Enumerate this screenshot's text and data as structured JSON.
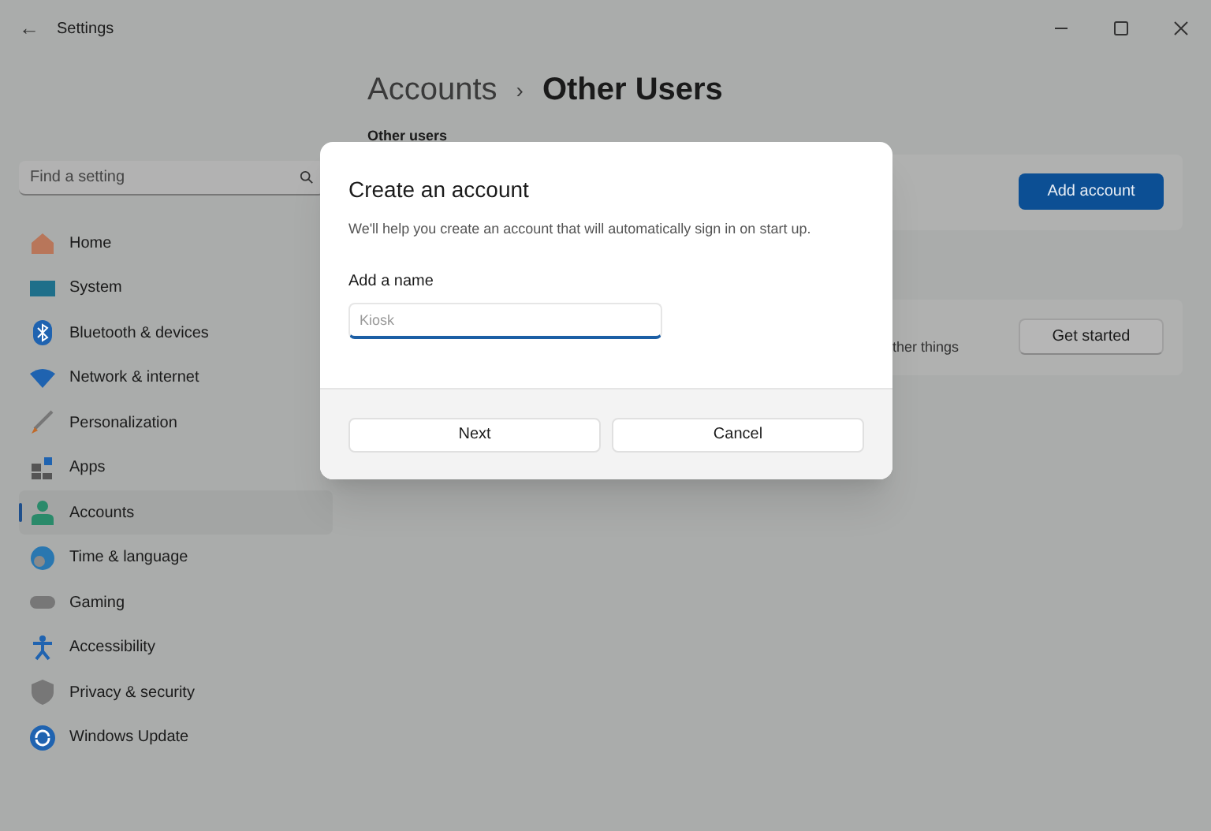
{
  "window": {
    "title": "Settings",
    "back": "←"
  },
  "search": {
    "placeholder": "Find a setting"
  },
  "nav": [
    {
      "label": "Home",
      "selected": false
    },
    {
      "label": "System",
      "selected": false
    },
    {
      "label": "Bluetooth & devices",
      "selected": false
    },
    {
      "label": "Network & internet",
      "selected": false
    },
    {
      "label": "Personalization",
      "selected": false
    },
    {
      "label": "Apps",
      "selected": false
    },
    {
      "label": "Accounts",
      "selected": true
    },
    {
      "label": "Time & language",
      "selected": false
    },
    {
      "label": "Gaming",
      "selected": false
    },
    {
      "label": "Accessibility",
      "selected": false
    },
    {
      "label": "Privacy & security",
      "selected": false
    },
    {
      "label": "Windows Update",
      "selected": false
    }
  ],
  "breadcrumb": {
    "parent": "Accounts",
    "separator": "›",
    "current": "Other Users"
  },
  "section_title": "Other users",
  "cards": [
    {
      "button": "Add account",
      "primary": true
    },
    {
      "text": "ther things",
      "button": "Get started",
      "primary": false
    }
  ],
  "dialog": {
    "title": "Create an account",
    "subtitle": "We'll help you create an account that will automatically sign in on start up.",
    "field_label": "Add a name",
    "field_placeholder": "Kiosk",
    "buttons": [
      "Next",
      "Cancel"
    ]
  }
}
